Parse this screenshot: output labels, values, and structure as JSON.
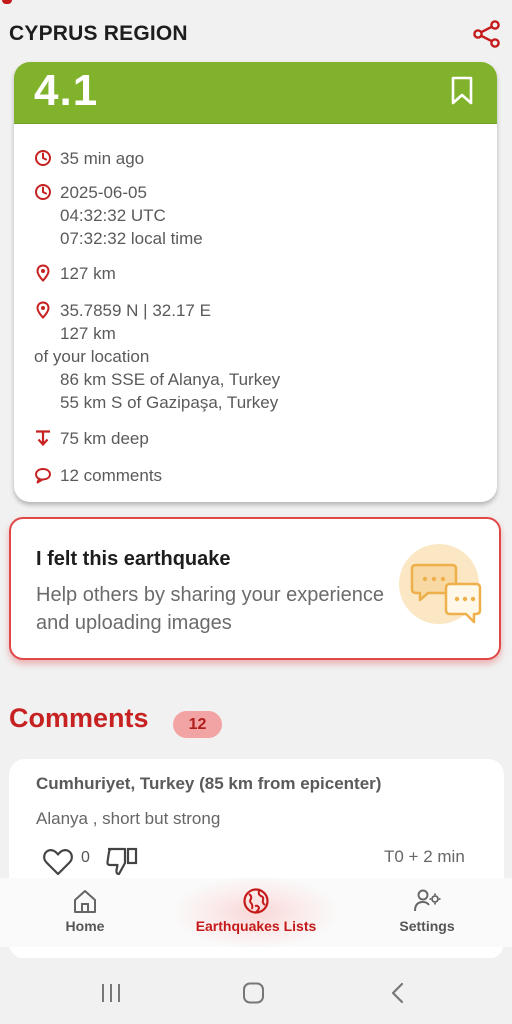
{
  "header": {
    "region": "CYPRUS REGION",
    "share_icon": "share-icon"
  },
  "event": {
    "magnitude": "4.1",
    "magnitude_color": "#80b22c",
    "time_ago": "35 min ago",
    "date": "2025-06-05",
    "utc_time": "04:32:32 UTC",
    "local_time": "07:32:32 local time",
    "distance": "127 km",
    "coordinates": "35.7859 N | 32.17 E",
    "distance_from_you": "127 km",
    "of_your_location": "of your location",
    "nearby_1": "86 km SSE of Alanya, Turkey",
    "nearby_2": "55 km S of Gazipaşa, Turkey",
    "depth": "75 km deep",
    "comments_count": "12 comments"
  },
  "felt": {
    "title": "I felt this earthquake",
    "description": "Help others by sharing your experience and uploading images"
  },
  "comments": {
    "title": "Comments",
    "count": "12",
    "items": [
      {
        "author": "Cumhuriyet, Turkey (85 km from epicenter)",
        "text": "Alanya , short but strong",
        "likes": "0",
        "time": "T0 + 2 min"
      }
    ]
  },
  "nav": {
    "items": [
      {
        "label": "Home",
        "icon": "home-icon"
      },
      {
        "label": "Earthquakes Lists",
        "icon": "globe-icon",
        "active": true
      },
      {
        "label": "Settings",
        "icon": "settings-icon"
      }
    ]
  },
  "colors": {
    "accent": "#c41a1a",
    "magnitude_green": "#80b22c"
  }
}
